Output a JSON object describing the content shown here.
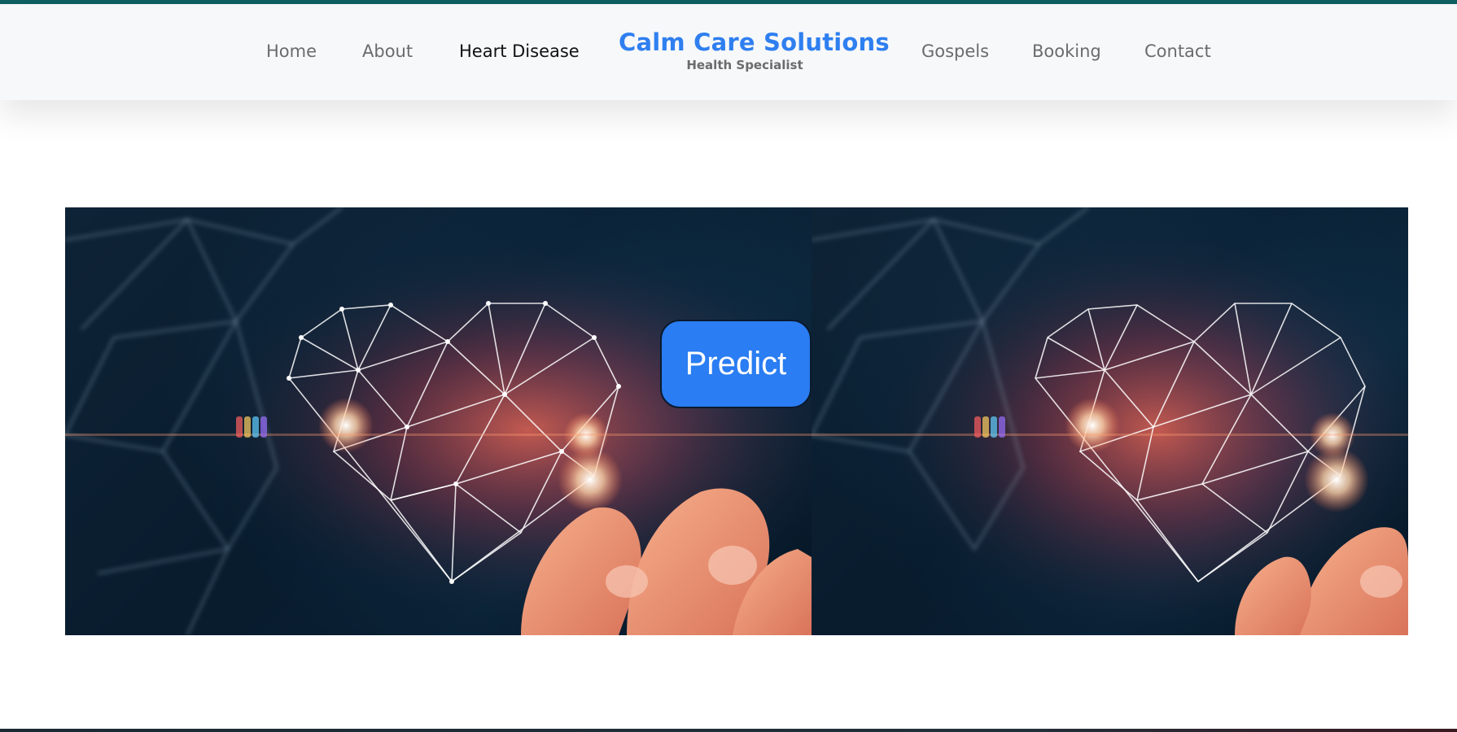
{
  "nav": {
    "left": [
      {
        "label": "Home"
      },
      {
        "label": "About"
      },
      {
        "label": "Heart Disease",
        "active": true
      }
    ],
    "right": [
      {
        "label": "Gospels"
      },
      {
        "label": "Booking"
      },
      {
        "label": "Contact"
      }
    ],
    "brand": {
      "title": "Calm Care Solutions",
      "subtitle": "Health Specialist"
    }
  },
  "hero": {
    "image_subject": "glowing wireframe heart held by fingertips",
    "predict_label": "Predict"
  },
  "colors": {
    "accent": "#2f7ff0",
    "button": "#2a7df2",
    "top_strip": "#0f5f63",
    "nav_background": "#f7f8fa"
  }
}
